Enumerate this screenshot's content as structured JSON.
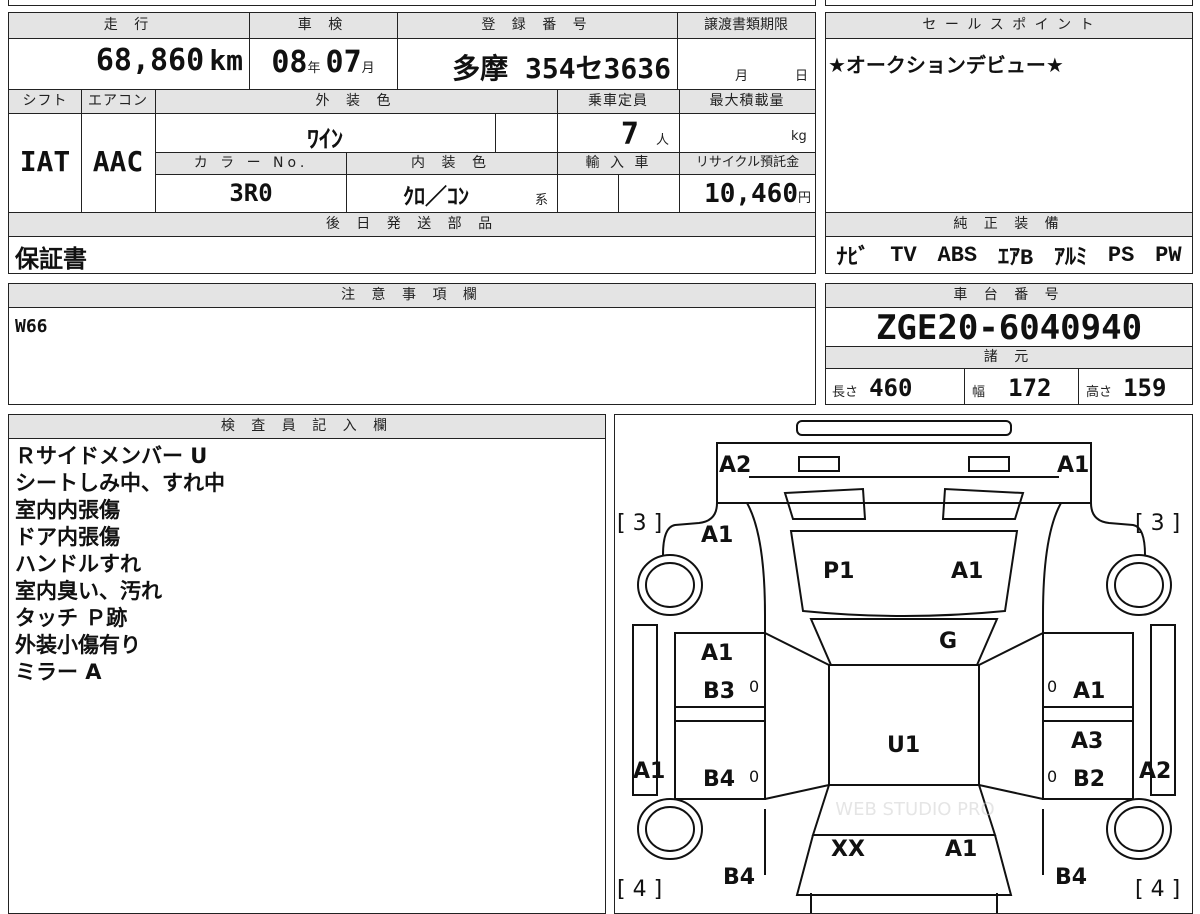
{
  "vehicle": {
    "mileage_label": "走 行",
    "mileage_value": "68,860",
    "mileage_unit": "km",
    "inspection_label": "車 検",
    "inspection_year": "08",
    "inspection_year_unit": "年",
    "inspection_month": "07",
    "inspection_month_unit": "月",
    "registration_label": "登 録 番 号",
    "registration_value": "多摩 354セ3636",
    "transfer_label": "譲渡書類期限",
    "transfer_month_unit": "月",
    "transfer_day_unit": "日",
    "shift_label": "シフト",
    "shift_value": "IAT",
    "aircon_label": "エアコン",
    "aircon_value": "AAC",
    "exterior_color_label": "外 装 色",
    "exterior_color_value": "ﾜｲﾝ",
    "capacity_label": "乗車定員",
    "capacity_value": "7",
    "capacity_unit": "人",
    "max_load_label": "最大積載量",
    "max_load_unit": "kg",
    "color_no_label": "カ ラ ー No.",
    "color_no_value": "3R0",
    "interior_color_label": "内 装 色",
    "interior_color_value": "ｸﾛ／ｺﾝ",
    "interior_color_suffix": "系",
    "import_label": "輸 入 車",
    "recycle_label": "リサイクル預託金",
    "recycle_value": "10,460",
    "recycle_unit": "円",
    "parts_label": "後 日 発 送 部 品",
    "parts_value": "保証書"
  },
  "sales_point": {
    "label": "セ ー ル ス ポ イ ン ト",
    "value": "★オークションデビュー★"
  },
  "equipment": {
    "label": "純 正 装 備",
    "items": [
      "ﾅﾋﾞ",
      "TV",
      "ABS",
      "ｴｱB",
      "ｱﾙﾐ",
      "PS",
      "PW"
    ]
  },
  "caution": {
    "label": "注 意 事 項 欄",
    "value": "W66"
  },
  "chassis": {
    "label": "車 台 番 号",
    "value": "ZGE20-6040940",
    "spec_label": "諸 元",
    "length_label": "長さ",
    "length_value": "460",
    "width_label": "幅",
    "width_value": "172",
    "height_label": "高さ",
    "height_value": "159"
  },
  "inspector": {
    "label": "検 査 員 記 入 欄",
    "notes": [
      "Ｒサイドメンバー U",
      "シートしみ中、すれ中",
      "室内内張傷",
      "ドア内張傷",
      "ハンドルすれ",
      "室内臭い、汚れ",
      "タッチ Ｐ跡",
      "外装小傷有り",
      "ミラー A"
    ]
  },
  "diagram": {
    "marks": {
      "front_left": "A2",
      "front_right": "A1",
      "fender_left": "A1",
      "hood_left": "P1",
      "hood_right": "A1",
      "windshield": "G",
      "front_door_left_1": "A1",
      "front_door_left_2": "B3",
      "front_door_right": "A1",
      "roof": "U1",
      "rear_door_right_1": "A3",
      "rear_door_right_2": "B2",
      "rear_door_left": "B4",
      "side_left": "A1",
      "side_right": "A2",
      "trunk_left": "XX",
      "trunk_right": "A1",
      "rear_left": "B4",
      "rear_right": "B4",
      "tire_fl": "[ 3 ]",
      "tire_fr": "[ 3 ]",
      "tire_rl": "[ 4 ]",
      "tire_rr": "[ 4 ]",
      "zero_1": "0",
      "zero_2": "0",
      "zero_3": "0",
      "zero_4": "0"
    }
  }
}
